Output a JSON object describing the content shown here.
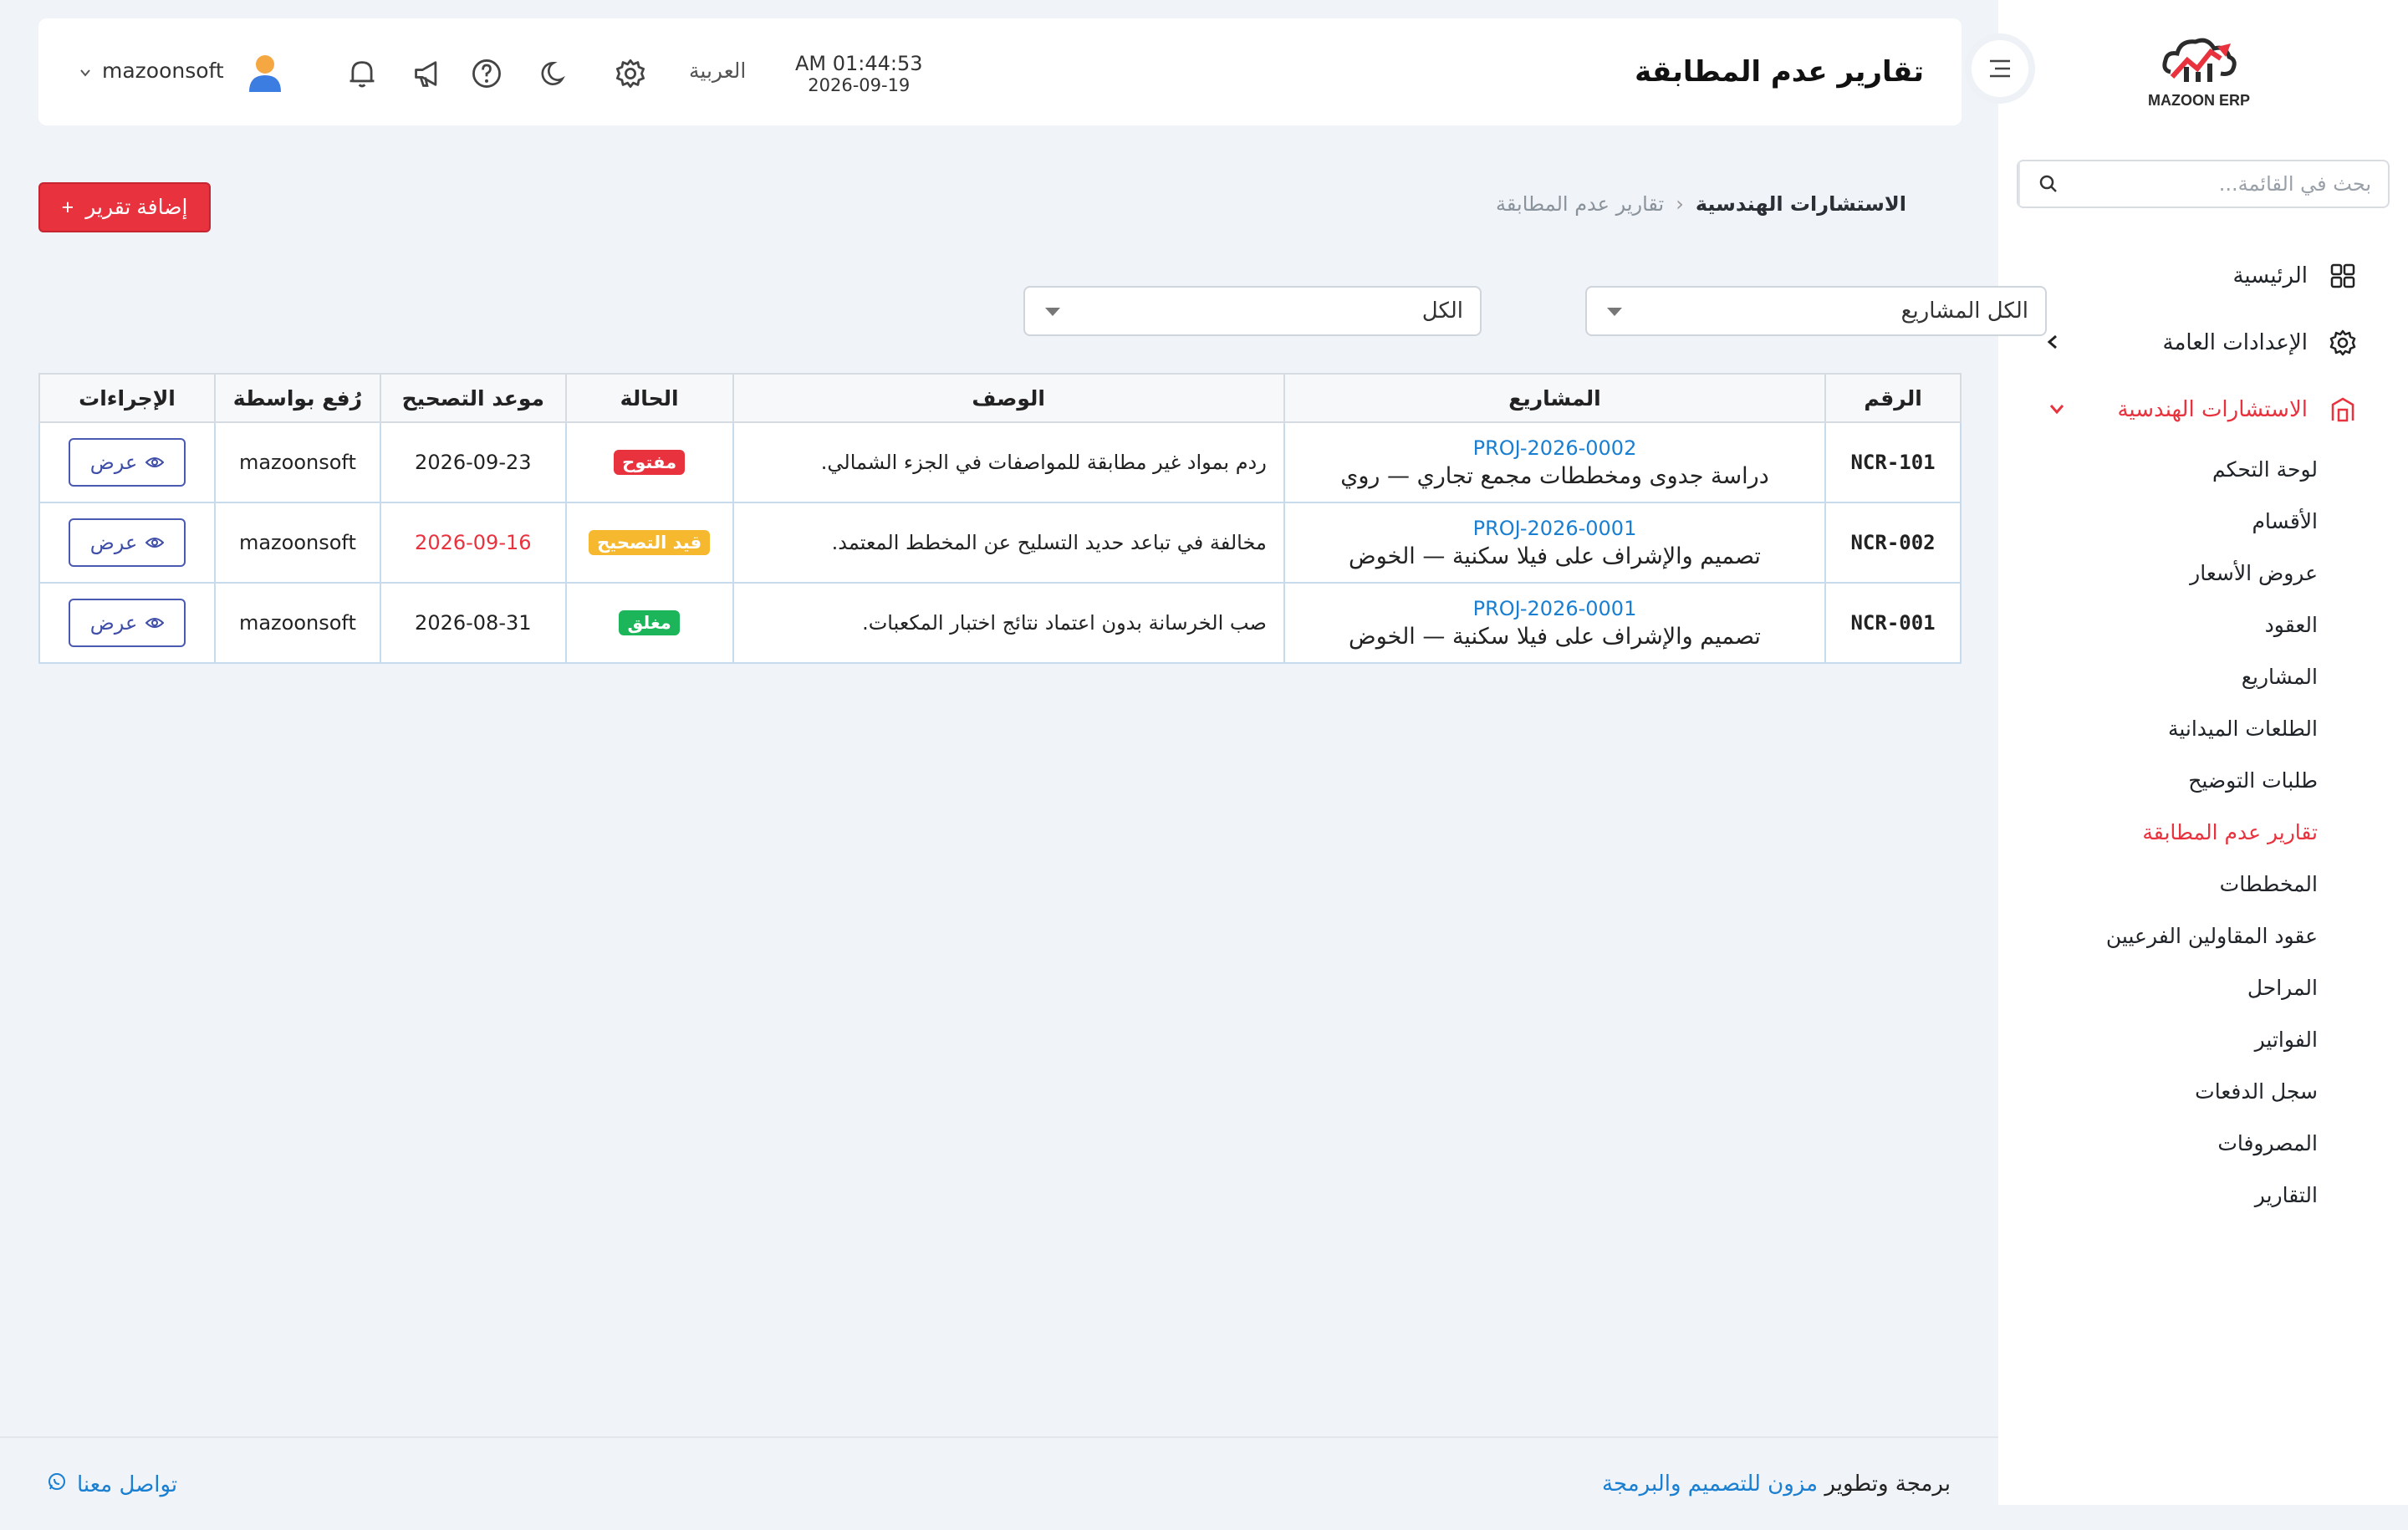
{
  "app": {
    "logo_text": "MAZOON ERP"
  },
  "header": {
    "title": "تقارير عدم المطابقة",
    "time": "AM 01:44:53",
    "date": "2026-09-19",
    "language": "العربية",
    "username": "mazoonsoft"
  },
  "sidebar": {
    "search_placeholder": "بحث في القائمة...",
    "items": [
      {
        "label": "الرئيسية",
        "icon": "grid-icon"
      },
      {
        "label": "الإعدادات العامة",
        "icon": "gear-icon"
      },
      {
        "label": "الاستشارات الهندسية",
        "icon": "building-icon"
      }
    ],
    "sub_items": [
      "لوحة التحكم",
      "الأقسام",
      "عروض الأسعار",
      "العقود",
      "المشاريع",
      "الطلعات الميدانية",
      "طلبات التوضيح",
      "تقارير عدم المطابقة",
      "المخططات",
      "عقود المقاولين الفرعيين",
      "المراحل",
      "الفواتير",
      "سجل الدفعات",
      "المصروفات",
      "التقارير"
    ],
    "active_sub": "تقارير عدم المطابقة"
  },
  "breadcrumb": {
    "parent": "الاستشارات الهندسية",
    "current": "تقارير عدم المطابقة"
  },
  "toolbar": {
    "add_label": "إضافة تقرير"
  },
  "filters": {
    "project": "الكل المشاريع",
    "status": "الكل"
  },
  "table": {
    "headers": [
      "الرقم",
      "المشاريع",
      "الوصف",
      "الحالة",
      "موعد التصحيح",
      "رُفع بواسطة",
      "الإجراءات"
    ],
    "rows": [
      {
        "num": "NCR-101",
        "proj_code": "PROJ-2026-0002",
        "proj_name": "دراسة جدوى ومخططات مجمع تجاري — روي",
        "desc": "ردم بمواد غير مطابقة للمواصفات في الجزء الشمالي.",
        "status": "مفتوح",
        "status_color": "#e8333e",
        "due": "2026-09-23",
        "by": "mazoonsoft",
        "action": "عرض"
      },
      {
        "num": "NCR-002",
        "proj_code": "PROJ-2026-0001",
        "proj_name": "تصميم والإشراف على فيلا سكنية — الخوض",
        "desc": "مخالفة في تباعد حديد التسليح عن المخطط المعتمد.",
        "status": "قيد التصحيح",
        "status_color": "#f5b82e",
        "due": "2026-09-16",
        "by": "mazoonsoft",
        "action": "عرض"
      },
      {
        "num": "NCR-001",
        "proj_code": "PROJ-2026-0001",
        "proj_name": "تصميم والإشراف على فيلا سكنية — الخوض",
        "desc": "صب الخرسانة بدون اعتماد نتائج اختبار المكعبات.",
        "status": "مغلق",
        "status_color": "#1db55a",
        "due": "2026-08-31",
        "by": "mazoonsoft",
        "action": "عرض"
      }
    ]
  },
  "footer": {
    "credit_prefix": "برمجة وتطوير",
    "credit_link": "مزون للتصميم والبرمجة",
    "contact": "تواصل معنا"
  }
}
